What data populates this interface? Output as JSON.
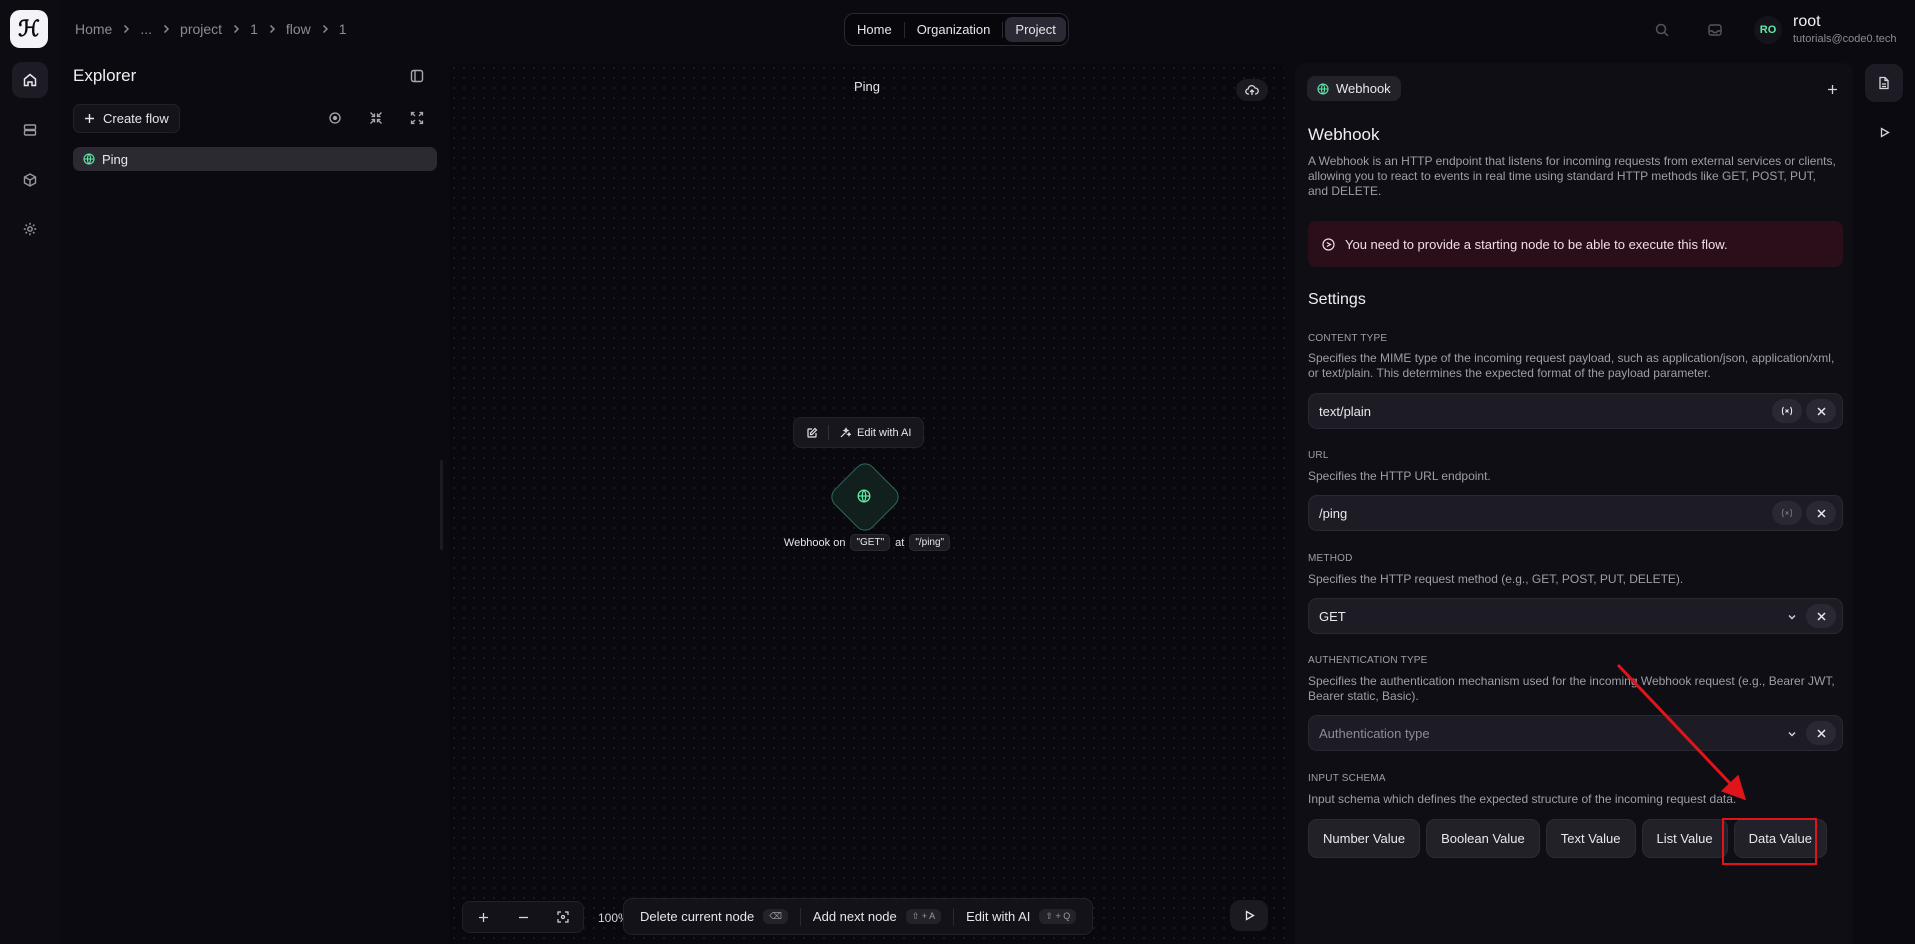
{
  "app": {
    "logo_letter": "ℋ"
  },
  "breadcrumb": [
    "Home",
    "...",
    "project",
    "1",
    "flow",
    "1"
  ],
  "top_tabs": [
    {
      "label": "Home",
      "active": false
    },
    {
      "label": "Organization",
      "active": false
    },
    {
      "label": "Project",
      "active": true
    }
  ],
  "user": {
    "initials": "RO",
    "name": "root",
    "email": "tutorials@code0.tech"
  },
  "explorer": {
    "title": "Explorer",
    "create_label": "Create flow",
    "flows": [
      {
        "label": "Ping",
        "icon": "globe-icon",
        "selected": true
      }
    ]
  },
  "canvas": {
    "title": "Ping",
    "ai_button": "Edit with AI",
    "node": {
      "label_prefix": "Webhook on",
      "method": "\"GET\"",
      "at": "at",
      "path": "\"/ping\"",
      "icon": "globe-icon"
    },
    "zoom": "100%",
    "actions": [
      {
        "label": "Delete current node",
        "kbd": "⌫"
      },
      {
        "label": "Add next node",
        "kbd": "⇧ + A"
      },
      {
        "label": "Edit with AI",
        "kbd": "⇧ + Q"
      }
    ]
  },
  "panel": {
    "chip": "Webhook",
    "title": "Webhook",
    "description": "A Webhook is an HTTP endpoint that listens for incoming requests from external services or clients, allowing you to react to events in real time using standard HTTP methods like GET, POST, PUT, and DELETE.",
    "alert": "You need to provide a starting node to be able to execute this flow.",
    "settings_title": "Settings",
    "content_type": {
      "label": "CONTENT TYPE",
      "description": "Specifies the MIME type of the incoming request payload, such as application/json, application/xml, or text/plain. This determines the expected format of the payload parameter.",
      "value": "text/plain"
    },
    "url": {
      "label": "URL",
      "description": "Specifies the HTTP URL endpoint.",
      "value": "/ping"
    },
    "method": {
      "label": "METHOD",
      "description": "Specifies the HTTP request method (e.g., GET, POST, PUT, DELETE).",
      "value": "GET"
    },
    "auth": {
      "label": "AUTHENTICATION TYPE",
      "description": "Specifies the authentication mechanism used for the incoming Webhook request (e.g., Bearer JWT, Bearer static, Basic).",
      "placeholder": "Authentication type"
    },
    "schema": {
      "label": "INPUT SCHEMA",
      "description": "Input schema which defines the expected structure of the incoming request data.",
      "buttons": [
        "Number Value",
        "Boolean Value",
        "Text Value",
        "List Value",
        "Data Value"
      ]
    }
  },
  "colors": {
    "accent_green": "#5ee9a6",
    "annotation_red": "#e0141b",
    "alert_bg": "#2a0f1a"
  }
}
